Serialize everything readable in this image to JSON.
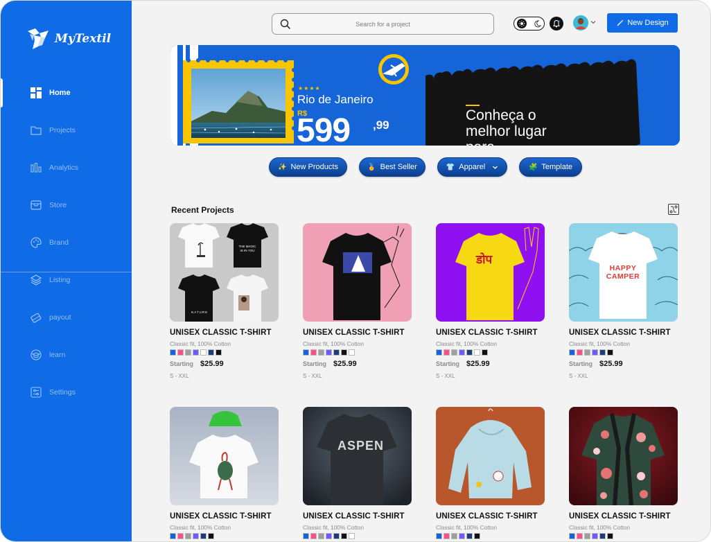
{
  "app": {
    "name": "MyTextil"
  },
  "sidebar": {
    "items": [
      {
        "label": "Home",
        "icon": "grid-icon",
        "active": true
      },
      {
        "label": "Projects",
        "icon": "folder-icon"
      },
      {
        "label": "Analytics",
        "icon": "bar-chart-icon"
      },
      {
        "label": "Store",
        "icon": "store-icon"
      },
      {
        "label": "Brand",
        "icon": "palette-icon"
      },
      {
        "label": "Listing",
        "icon": "layers-icon"
      },
      {
        "label": "payout",
        "icon": "card-icon"
      },
      {
        "label": "learn",
        "icon": "graduation-cap-icon"
      },
      {
        "label": "Settings",
        "icon": "sliders-icon"
      }
    ]
  },
  "topbar": {
    "search_placeholder": "Search for a project",
    "new_design_label": "New Design"
  },
  "banner": {
    "rating_stars": "★★★★",
    "place": "Rio de Janeiro",
    "currency": "R$",
    "price_main": "599",
    "price_cents": ",99",
    "headline": "Conheça o melhor lugar para"
  },
  "chips": [
    {
      "label": "New Products",
      "emoji": "✨"
    },
    {
      "label": "Best Seller",
      "emoji": "🏅"
    },
    {
      "label": "Apparel",
      "emoji": "👕",
      "dropdown": true
    },
    {
      "label": "Template",
      "emoji": "🧩"
    }
  ],
  "recent_projects": {
    "title": "Recent Projects",
    "starting_label": "Starting",
    "cards": [
      {
        "title": "UNISEX CLASSIC T-SHIRT",
        "subtitle": "Classic fit, 100% Cotton",
        "price": "$25.99",
        "sizes": "S - XXL"
      },
      {
        "title": "UNISEX CLASSIC T-SHIRT",
        "subtitle": "Classic fit, 100% Cotton",
        "price": "$25.99",
        "sizes": "S - XXL"
      },
      {
        "title": "UNISEX CLASSIC T-SHIRT",
        "subtitle": "Classic fit, 100% Cotton",
        "price": "$25.99",
        "sizes": "S - XXL"
      },
      {
        "title": "UNISEX CLASSIC T-SHIRT",
        "subtitle": "Classic fit, 100% Cotton",
        "price": "$25.99",
        "sizes": "S - XXL"
      },
      {
        "title": "UNISEX CLASSIC T-SHIRT",
        "subtitle": "Classic fit, 100% Cotton"
      },
      {
        "title": "UNISEX CLASSIC T-SHIRT",
        "subtitle": "Classic fit, 100% Cotton"
      },
      {
        "title": "UNISEX CLASSIC T-SHIRT",
        "subtitle": "Classic fit, 100% Cotton"
      },
      {
        "title": "UNISEX CLASSIC T-SHIRT",
        "subtitle": "Classic fit, 100% Cotton"
      }
    ],
    "shirt_texts": {
      "magic": "THE MAGIC IS IN YOU",
      "nature": "NATURE",
      "hindi": "डोप",
      "happy_camper": "HAPPY CAMPER",
      "aspen": "ASPEN"
    }
  },
  "colors": {
    "brand_blue": "#0f6ce6",
    "swatches": [
      "#1565d8",
      "#ff4f8b",
      "#9e9e9e",
      "#6b5cff",
      "#ffffff",
      "#1f3b7a",
      "#111111"
    ]
  }
}
